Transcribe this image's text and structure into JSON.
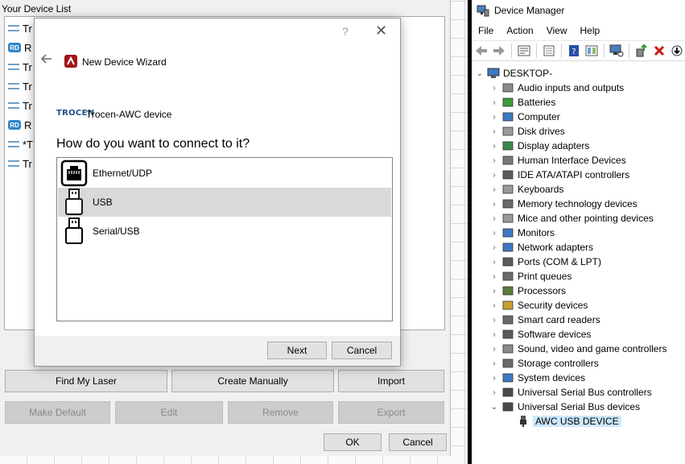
{
  "left_app": {
    "list_caption": "Your Device List",
    "device_list_items": [
      {
        "prefix": "Tr",
        "icon": "trocen-icon"
      },
      {
        "prefix": "R",
        "icon": "ruida-icon"
      },
      {
        "prefix": "Tr",
        "icon": "trocen-icon"
      },
      {
        "prefix": "Tr",
        "icon": "trocen-icon"
      },
      {
        "prefix": "Tr",
        "icon": "trocen-icon"
      },
      {
        "prefix": "R",
        "icon": "ruida-icon"
      },
      {
        "prefix": "*T",
        "icon": "trocen-icon"
      },
      {
        "prefix": "Tr",
        "icon": "trocen-icon"
      }
    ],
    "buttons_row1": {
      "find_my_laser": "Find My Laser",
      "create_manually": "Create Manually",
      "import": "Import"
    },
    "buttons_row2": {
      "make_default": "Make Default",
      "edit": "Edit",
      "remove": "Remove",
      "export": "Export"
    },
    "ok": "OK",
    "cancel": "Cancel"
  },
  "wizard": {
    "title": "New Device Wizard",
    "help_glyph": "?",
    "close_glyph": "✕",
    "brand": "TROCEN",
    "device_name": "Trocen-AWC device",
    "question": "How do you want to connect to it?",
    "options": [
      {
        "label": "Ethernet/UDP",
        "icon": "ethernet-port-icon",
        "selected": false
      },
      {
        "label": "USB",
        "icon": "usb-icon",
        "selected": true
      },
      {
        "label": "Serial/USB",
        "icon": "serial-usb-icon",
        "selected": false
      }
    ],
    "next": "Next",
    "cancel": "Cancel"
  },
  "device_manager": {
    "title": "Device Manager",
    "menu": [
      "File",
      "Action",
      "View",
      "Help"
    ],
    "root": "DESKTOP-",
    "categories": [
      {
        "label": "Audio inputs and outputs",
        "icon": "speaker-icon"
      },
      {
        "label": "Batteries",
        "icon": "battery-icon"
      },
      {
        "label": "Computer",
        "icon": "computer-icon"
      },
      {
        "label": "Disk drives",
        "icon": "disk-icon"
      },
      {
        "label": "Display adapters",
        "icon": "display-adapter-icon"
      },
      {
        "label": "Human Interface Devices",
        "icon": "hid-icon"
      },
      {
        "label": "IDE ATA/ATAPI controllers",
        "icon": "ide-icon"
      },
      {
        "label": "Keyboards",
        "icon": "keyboard-icon"
      },
      {
        "label": "Memory technology devices",
        "icon": "memory-icon"
      },
      {
        "label": "Mice and other pointing devices",
        "icon": "mouse-icon"
      },
      {
        "label": "Monitors",
        "icon": "monitor-icon"
      },
      {
        "label": "Network adapters",
        "icon": "network-icon"
      },
      {
        "label": "Ports (COM & LPT)",
        "icon": "port-icon"
      },
      {
        "label": "Print queues",
        "icon": "printer-icon"
      },
      {
        "label": "Processors",
        "icon": "processor-icon"
      },
      {
        "label": "Security devices",
        "icon": "security-icon"
      },
      {
        "label": "Smart card readers",
        "icon": "smart-card-icon"
      },
      {
        "label": "Software devices",
        "icon": "software-device-icon"
      },
      {
        "label": "Sound, video and game controllers",
        "icon": "sound-icon"
      },
      {
        "label": "Storage controllers",
        "icon": "storage-icon"
      },
      {
        "label": "System devices",
        "icon": "system-icon"
      },
      {
        "label": "Universal Serial Bus controllers",
        "icon": "usb-controller-icon"
      },
      {
        "label": "Universal Serial Bus devices",
        "icon": "usb-device-icon",
        "expanded": true
      }
    ],
    "child_device": "AWC USB DEVICE"
  }
}
